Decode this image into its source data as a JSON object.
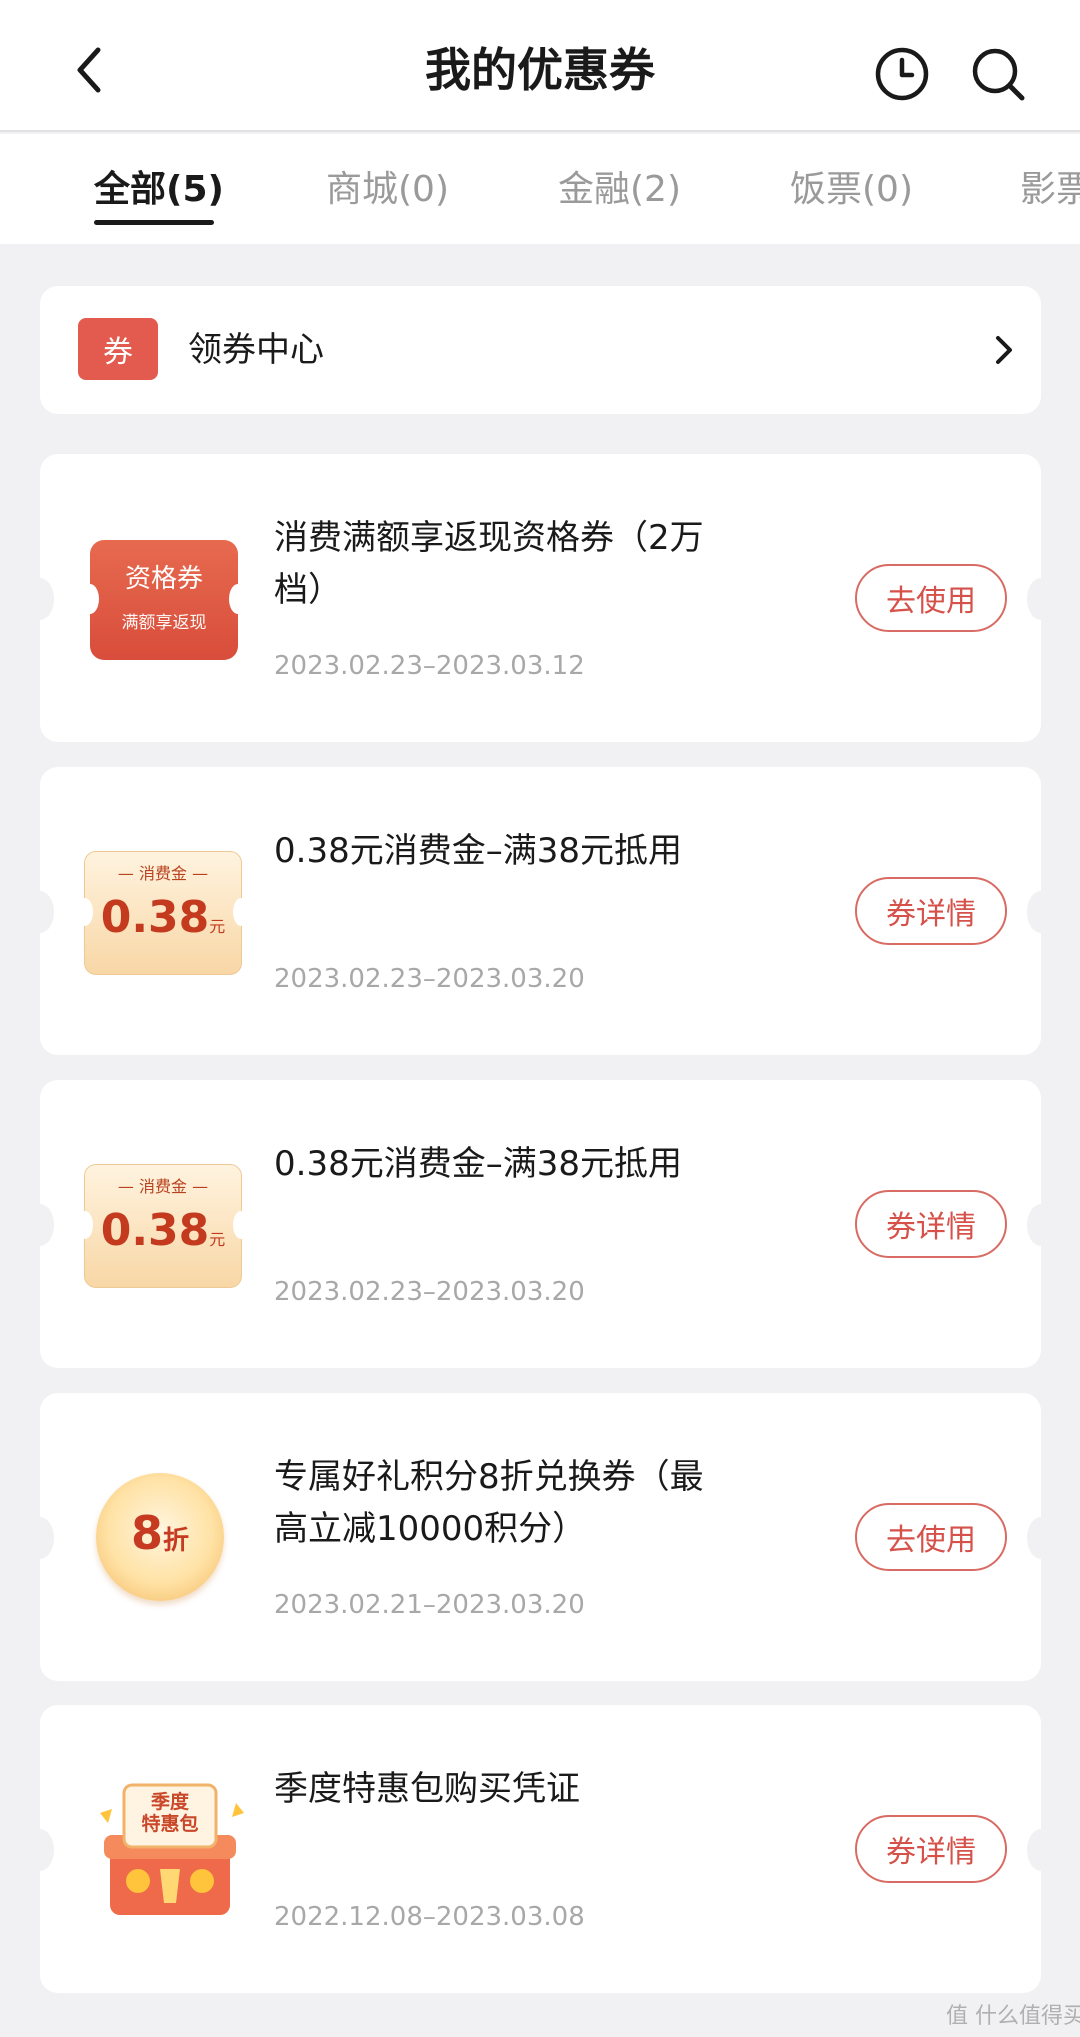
{
  "header": {
    "title": "我的优惠券"
  },
  "tabs": [
    {
      "label": "全部(5)"
    },
    {
      "label": "商城(0)"
    },
    {
      "label": "金融(2)"
    },
    {
      "label": "饭票(0)"
    },
    {
      "label": "影票"
    }
  ],
  "coupon_center": {
    "badge": "券",
    "label": "领券中心"
  },
  "coupons": [
    {
      "thumb_line1": "资格券",
      "thumb_line2": "满额享返现",
      "title": "消费满额享返现资格券（2万档）",
      "date": "2023.02.23–2023.03.12",
      "button": "去使用"
    },
    {
      "thumb_line1": "消费金",
      "thumb_value": "0.38",
      "thumb_unit": "元",
      "title": "0.38元消费金–满38元抵用",
      "date": "2023.02.23–2023.03.20",
      "button": "券详情"
    },
    {
      "thumb_line1": "消费金",
      "thumb_value": "0.38",
      "thumb_unit": "元",
      "title": "0.38元消费金–满38元抵用",
      "date": "2023.02.23–2023.03.20",
      "button": "券详情"
    },
    {
      "thumb_value": "8",
      "thumb_unit": "折",
      "title": "专属好礼积分8折兑换券（最高立减10000积分）",
      "date": "2023.02.21–2023.03.20",
      "button": "去使用"
    },
    {
      "thumb_line1": "季度",
      "thumb_line2": "特惠包",
      "title": "季度特惠包购买凭证",
      "date": "2022.12.08–2023.03.08",
      "button": "券详情"
    }
  ],
  "watermark": "值 什么值得买",
  "colors": {
    "accent": "#d5514a",
    "active_tab": "#1a1a1a",
    "inactive_tab": "#9a9a9a"
  }
}
